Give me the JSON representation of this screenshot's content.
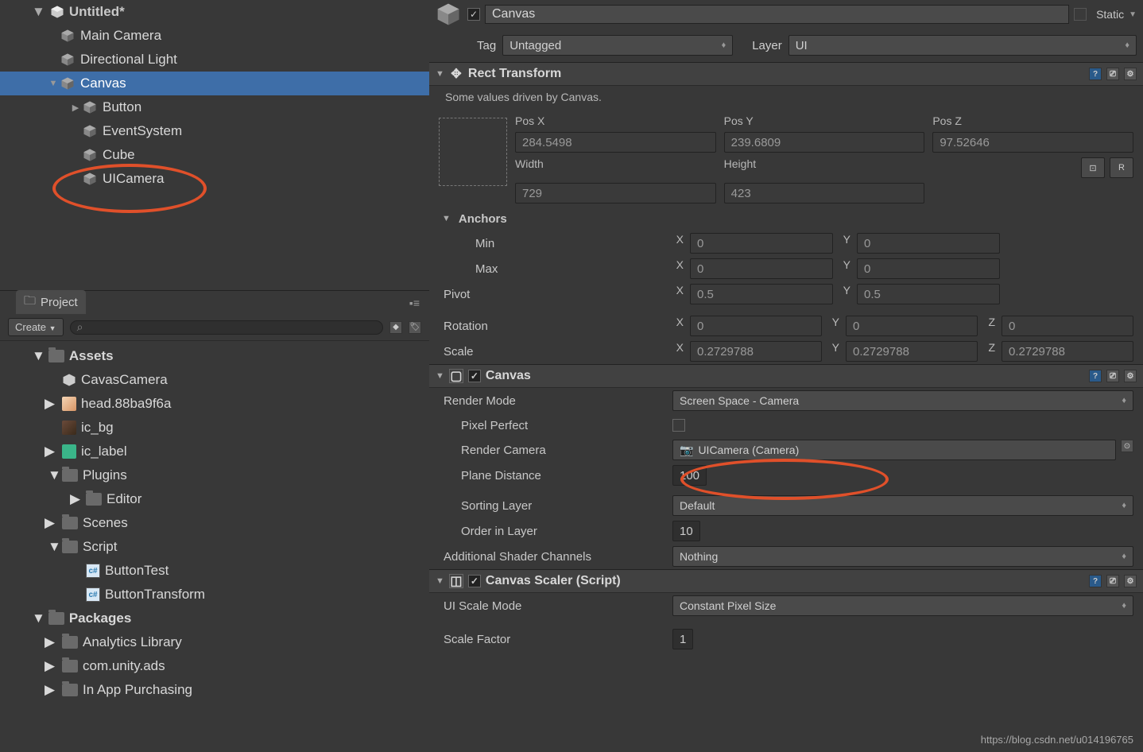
{
  "hierarchy": {
    "scene": "Untitled*",
    "items": [
      {
        "name": "Main Camera",
        "indent": 60,
        "fold": ""
      },
      {
        "name": "Directional Light",
        "indent": 60,
        "fold": ""
      },
      {
        "name": "Canvas",
        "indent": 60,
        "fold": "▼",
        "selected": true
      },
      {
        "name": "Button",
        "indent": 88,
        "fold": "▶"
      },
      {
        "name": "EventSystem",
        "indent": 88,
        "fold": ""
      },
      {
        "name": "Cube",
        "indent": 88,
        "fold": ""
      },
      {
        "name": "UICamera",
        "indent": 88,
        "fold": ""
      }
    ]
  },
  "project": {
    "tab": "Project",
    "create": "Create",
    "assets_root": "Assets",
    "items": [
      {
        "name": "CavasCamera",
        "indent": 78,
        "icon": "unity"
      },
      {
        "name": "head.88ba9f6a",
        "indent": 78,
        "icon": "head",
        "fold": "▶",
        "foldpad": 56
      },
      {
        "name": "ic_bg",
        "indent": 78,
        "icon": "bg"
      },
      {
        "name": "ic_label",
        "indent": 78,
        "icon": "label",
        "fold": "▶",
        "foldpad": 56
      },
      {
        "name": "Plugins",
        "indent": 78,
        "icon": "folder",
        "fold": "▼",
        "foldpad": 60
      },
      {
        "name": "Editor",
        "indent": 108,
        "icon": "folder",
        "fold": "▶",
        "foldpad": 88
      },
      {
        "name": "Scenes",
        "indent": 78,
        "icon": "folder",
        "fold": "▶",
        "foldpad": 56
      },
      {
        "name": "Script",
        "indent": 78,
        "icon": "folder",
        "fold": "▼",
        "foldpad": 60
      },
      {
        "name": "ButtonTest",
        "indent": 108,
        "icon": "cs"
      },
      {
        "name": "ButtonTransform",
        "indent": 108,
        "icon": "cs"
      }
    ],
    "packages": "Packages",
    "pkg_items": [
      {
        "name": "Analytics Library",
        "indent": 78,
        "icon": "folder",
        "fold": "▶",
        "foldpad": 56
      },
      {
        "name": "com.unity.ads",
        "indent": 78,
        "icon": "folder",
        "fold": "▶",
        "foldpad": 56
      },
      {
        "name": "In App Purchasing",
        "indent": 78,
        "icon": "folder",
        "fold": "▶",
        "foldpad": 56
      }
    ]
  },
  "inspector": {
    "obj_name": "Canvas",
    "static": "Static",
    "tag_lbl": "Tag",
    "tag_val": "Untagged",
    "layer_lbl": "Layer",
    "layer_val": "UI",
    "rect_title": "Rect Transform",
    "driven": "Some values driven by Canvas.",
    "posx_lbl": "Pos X",
    "posy_lbl": "Pos Y",
    "posz_lbl": "Pos Z",
    "posx": "284.5498",
    "posy": "239.6809",
    "posz": "97.52646",
    "width_lbl": "Width",
    "height_lbl": "Height",
    "width": "729",
    "height": "423",
    "anchors": "Anchors",
    "min_lbl": "Min",
    "max_lbl": "Max",
    "minx": "0",
    "miny": "0",
    "maxx": "0",
    "maxy": "0",
    "pivot": "Pivot",
    "pivotx": "0.5",
    "pivoty": "0.5",
    "rotation": "Rotation",
    "rotx": "0",
    "roty": "0",
    "rotz": "0",
    "scale": "Scale",
    "sx": "0.2729788",
    "sy": "0.2729788",
    "sz": "0.2729788",
    "canvas_title": "Canvas",
    "render_mode_lbl": "Render Mode",
    "render_mode": "Screen Space - Camera",
    "pixel_perfect": "Pixel Perfect",
    "render_cam_lbl": "Render Camera",
    "render_cam": "UICamera (Camera)",
    "plane_dist_lbl": "Plane Distance",
    "plane_dist": "100",
    "sort_layer_lbl": "Sorting Layer",
    "sort_layer": "Default",
    "order_lbl": "Order in Layer",
    "order": "10",
    "addl_lbl": "Additional Shader Channels",
    "addl": "Nothing",
    "scaler_title": "Canvas Scaler (Script)",
    "scale_mode_lbl": "UI Scale Mode",
    "scale_mode": "Constant Pixel Size",
    "scale_factor_lbl": "Scale Factor",
    "scale_factor": "1"
  },
  "watermark": "https://blog.csdn.net/u014196765"
}
